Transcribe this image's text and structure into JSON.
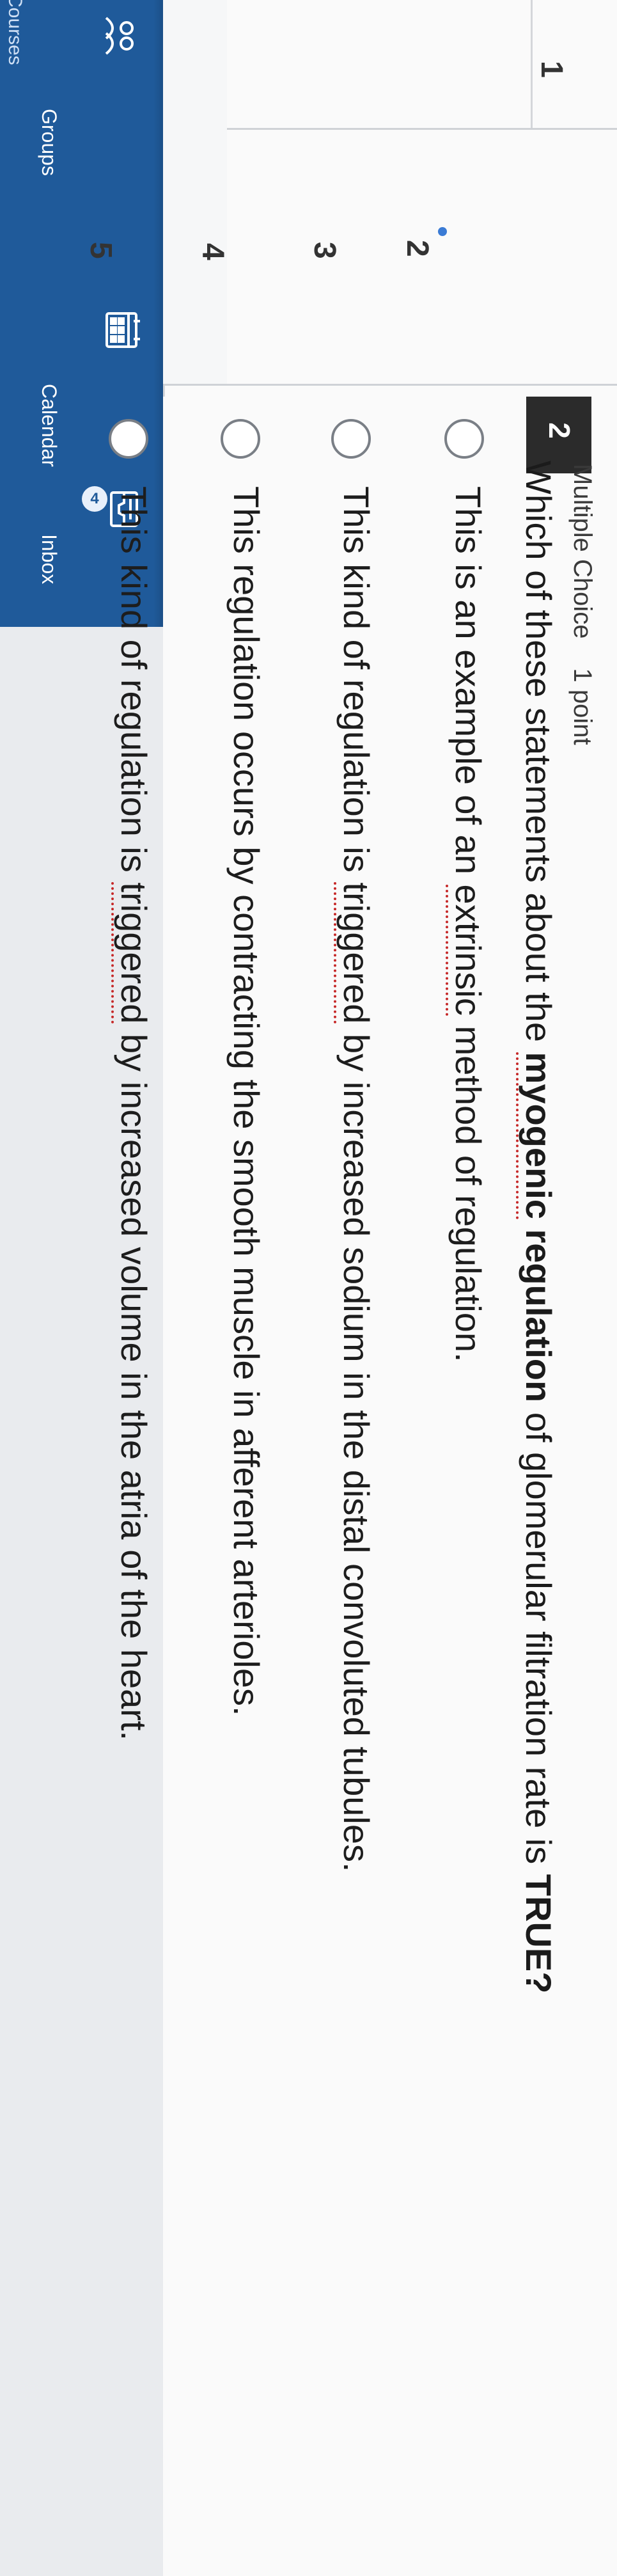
{
  "nav": {
    "items": [
      {
        "label": "Groups",
        "icon": "groups-icon"
      },
      {
        "label": "Calendar",
        "icon": "calendar-icon"
      },
      {
        "label": "Inbox",
        "icon": "inbox-icon",
        "badge": "4"
      }
    ],
    "top_label": "Courses"
  },
  "question_numbers": [
    "1",
    "2",
    "3",
    "4",
    "5"
  ],
  "question": {
    "number": "2",
    "type": "Multiple Choice",
    "points": "1 point",
    "prompt_pre": "Which of these statements about the ",
    "prompt_bold_myogenic": "myogenic",
    "prompt_mid": " regulation",
    "prompt_post": " of glomerular filtration rate is ",
    "prompt_true": "TRUE?",
    "options": [
      {
        "pre": "This is an example of an ",
        "red": "extrinsic",
        "post": " method of regulation."
      },
      {
        "pre": "This kind of regulation is ",
        "red": "triggered",
        "post": " by increased sodium in the distal convoluted tubules."
      },
      {
        "pre": "This regulation occurs by contracting the smooth muscle in afferent arterioles.",
        "red": "",
        "post": ""
      },
      {
        "pre": "This kind of regulation is ",
        "red": "triggered",
        "post": " by increased volume in the atria of the heart."
      }
    ]
  }
}
